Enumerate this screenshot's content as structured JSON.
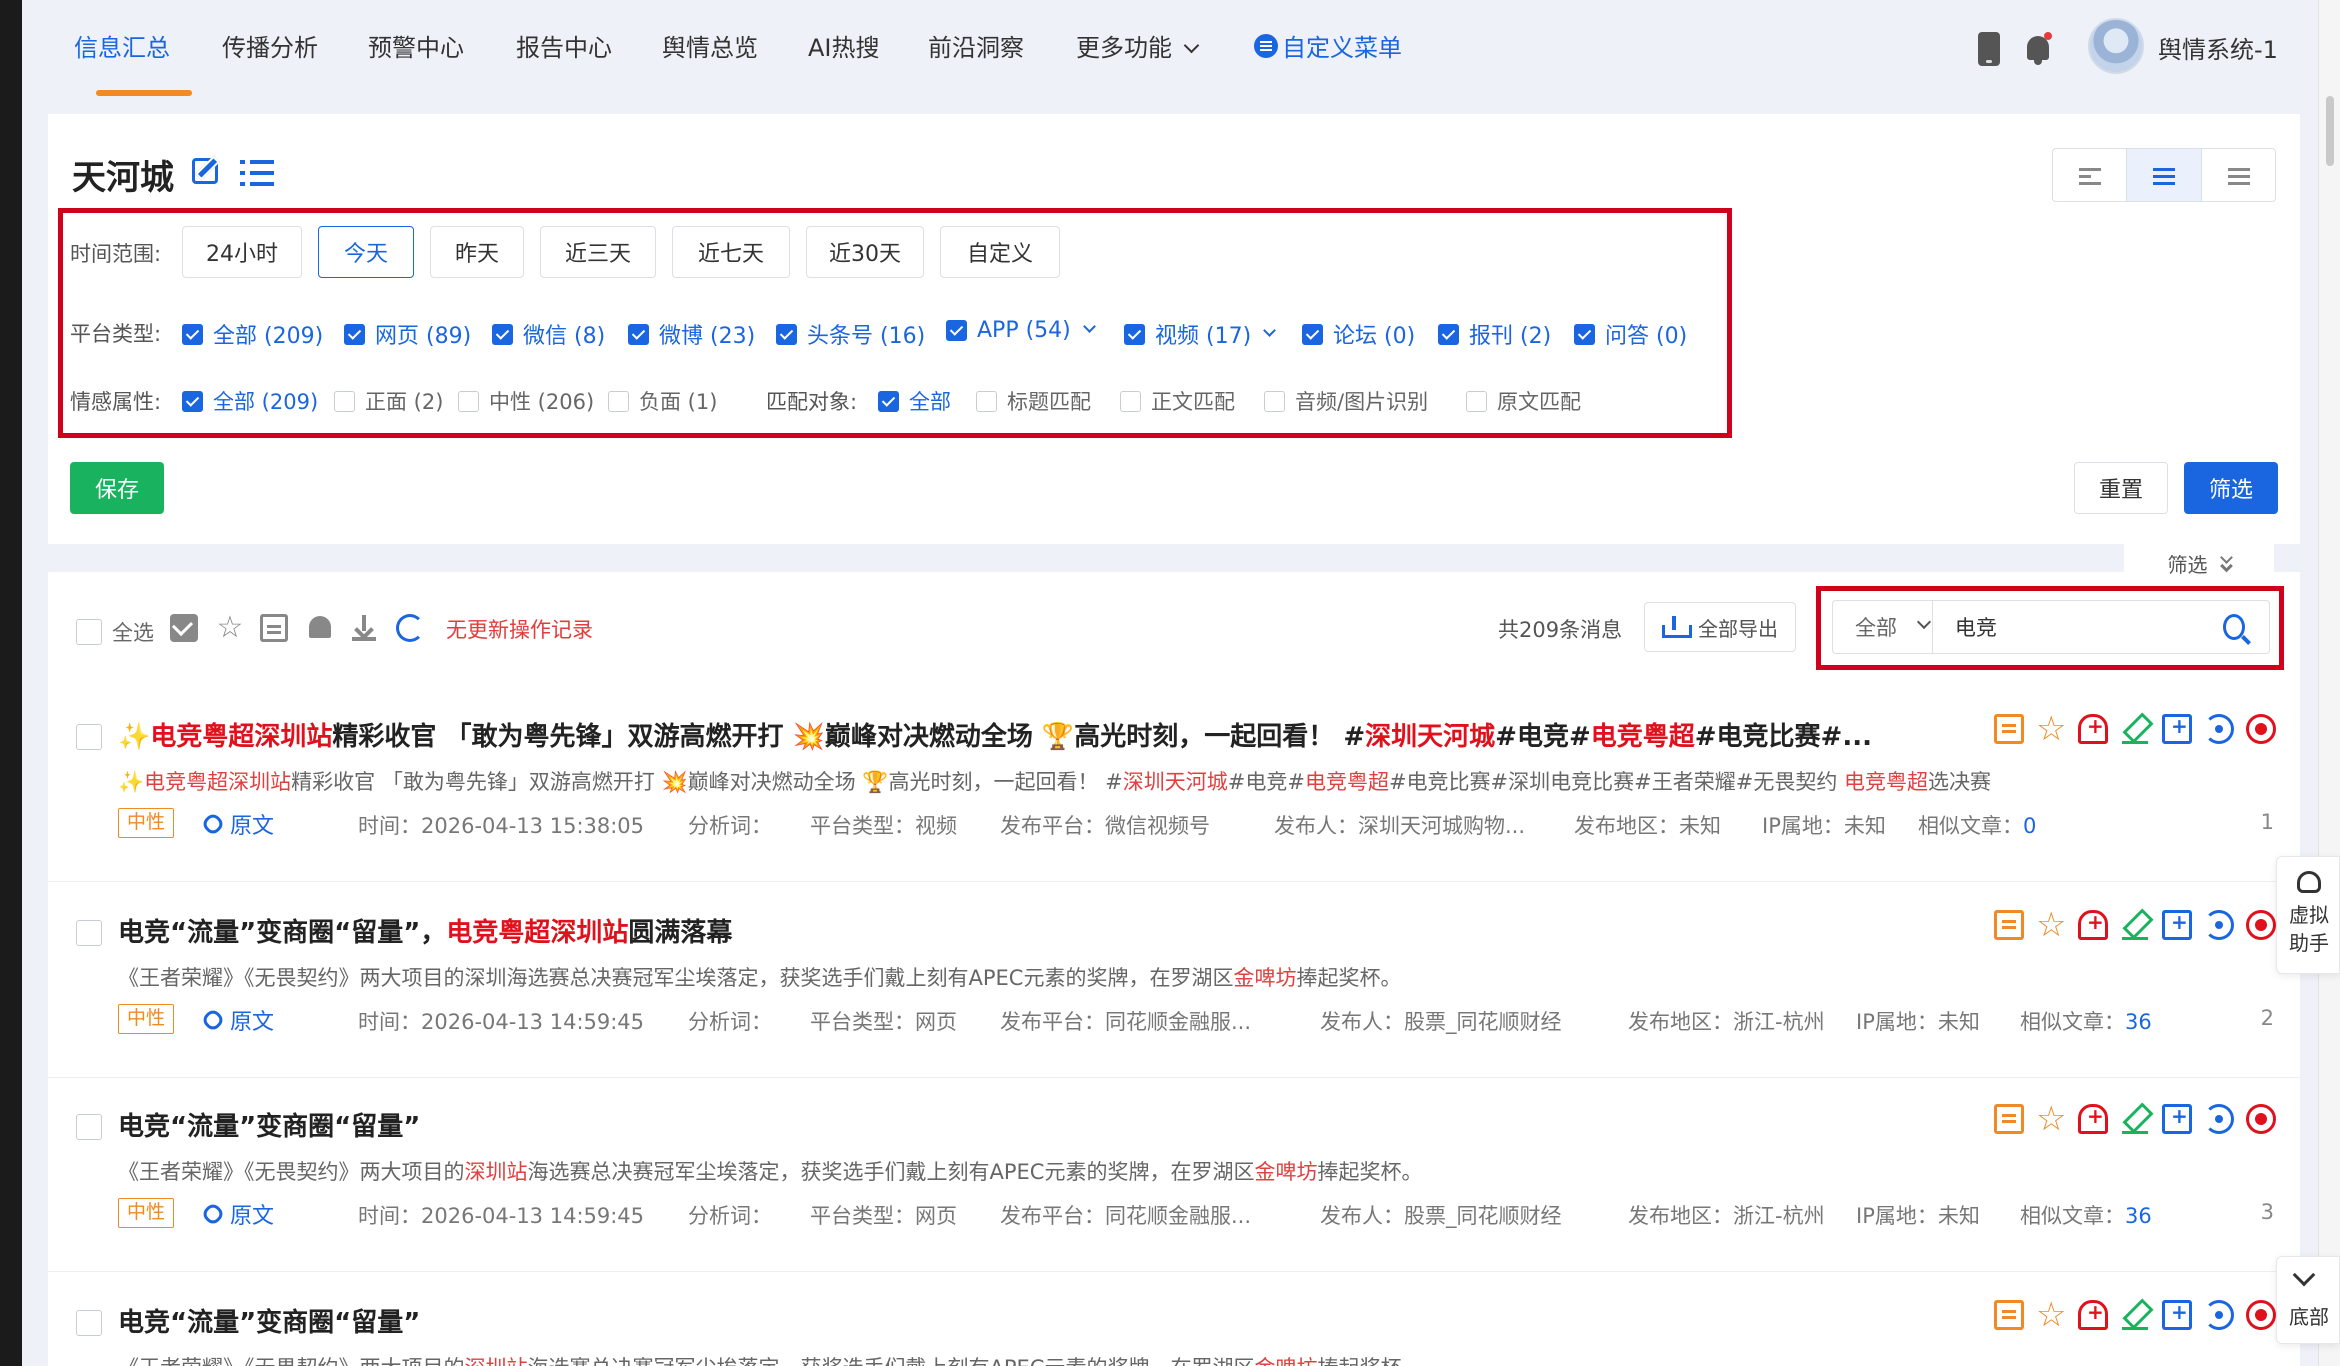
{
  "nav": {
    "tabs": [
      "信息汇总",
      "传播分析",
      "预警中心",
      "报告中心",
      "舆情总览",
      "AI热搜",
      "前沿洞察"
    ],
    "more_label": "更多功能",
    "custom_menu_label": "自定义菜单",
    "username": "舆情系统-1"
  },
  "filter": {
    "page_title": "天河城",
    "time_label": "时间范围:",
    "time_options": [
      "24小时",
      "今天",
      "昨天",
      "近三天",
      "近七天",
      "近30天",
      "自定义"
    ],
    "time_selected": "今天",
    "platform_label": "平台类型:",
    "platforms": [
      "全部 (209)",
      "网页 (89)",
      "微信 (8)",
      "微博 (23)",
      "头条号 (16)",
      "APP (54)",
      "视频 (17)",
      "论坛 (0)",
      "报刊 (2)",
      "问答 (0)"
    ],
    "sentiment_label": "情感属性:",
    "sentiments": [
      "全部 (209)",
      "正面 (2)",
      "中性 (206)",
      "负面 (1)"
    ],
    "match_label": "匹配对象:",
    "match_options": [
      "全部",
      "标题匹配",
      "正文匹配",
      "音频/图片识别",
      "原文匹配"
    ],
    "save_label": "保存",
    "reset_label": "重置",
    "submit_label": "筛选",
    "collapse_label": "筛选"
  },
  "toolbar": {
    "select_all_label": "全选",
    "no_record_label": "无更新操作记录",
    "total_label": "共209条消息",
    "export_label": "全部导出",
    "search_scope": "全部",
    "search_value": "电竞"
  },
  "items": [
    {
      "title_parts": [
        "✨",
        "电竞粤超深圳站",
        "精彩收官 「敢为粤先锋」双游高燃开打 💥巅峰对决燃动全场 🏆高光时刻，一起回看！ #",
        "深圳天河城",
        "#电竞#",
        "电竞粤超",
        "#电竞比赛#..."
      ],
      "summary_parts": [
        "✨",
        "电竞粤超深圳站",
        "精彩收官 「敢为粤先锋」双游高燃开打 💥巅峰对决燃动全场 🏆高光时刻，一起回看！ #",
        "深圳天河城",
        "#电竞#",
        "电竞粤超",
        "#电竞比赛#深圳电竞比赛#王者荣耀#无畏契约 ",
        "电竞粤超",
        "选决赛"
      ],
      "sentiment": "中性",
      "orig_label": "原文",
      "time": "时间：2026-04-13 15:38:05",
      "keywords": "分析词：",
      "platform_type": "平台类型：视频",
      "platform": "发布平台：微信视频号",
      "author": "发布人：深圳天河城购物...",
      "region": "发布地区：未知",
      "ip": "IP属地：未知",
      "similar_label": "相似文章：",
      "similar_count": "0",
      "index": "1"
    },
    {
      "title_parts": [
        "电竞“流量”变商圈“留量”，",
        "电竞粤超深圳站",
        "圆满落幕"
      ],
      "summary_parts": [
        "《王者荣耀》《无畏契约》两大项目的深圳海选赛总决赛冠军尘埃落定，获奖选手们戴上刻有APEC元素的奖牌，在罗湖区",
        "金啤坊",
        "捧起奖杯。"
      ],
      "sentiment": "中性",
      "orig_label": "原文",
      "time": "时间：2026-04-13 14:59:45",
      "keywords": "分析词：",
      "platform_type": "平台类型：网页",
      "platform": "发布平台：同花顺金融服...",
      "author": "发布人：股票_同花顺财经",
      "region": "发布地区：浙江-杭州",
      "ip": "IP属地：未知",
      "similar_label": "相似文章：",
      "similar_count": "36",
      "index": "2"
    },
    {
      "title_parts": [
        "电竞“流量”变商圈“留量”"
      ],
      "summary_parts": [
        "《王者荣耀》《无畏契约》两大项目的",
        "深圳站",
        "海选赛总决赛冠军尘埃落定，获奖选手们戴上刻有APEC元素的奖牌，在罗湖区",
        "金啤坊",
        "捧起奖杯。"
      ],
      "sentiment": "中性",
      "orig_label": "原文",
      "time": "时间：2026-04-13 14:59:45",
      "keywords": "分析词：",
      "platform_type": "平台类型：网页",
      "platform": "发布平台：同花顺金融服...",
      "author": "发布人：股票_同花顺财经",
      "region": "发布地区：浙江-杭州",
      "ip": "IP属地：未知",
      "similar_label": "相似文章：",
      "similar_count": "36",
      "index": "3"
    },
    {
      "title_parts": [
        "电竞“流量”变商圈“留量”"
      ],
      "summary_parts": [
        "《王者荣耀》《无畏契约》两大项目的",
        "深圳站",
        "海选赛总决赛冠军尘埃落定，获奖选手们戴上刻有APEC元素的奖牌，在罗湖区",
        "金啤坊",
        "捧起奖杯。"
      ]
    }
  ],
  "widgets": {
    "assistant_label": "虚拟助手",
    "bottom_label": "底部"
  },
  "colors": {
    "accent": "#1a66e0",
    "highlight": "#e0101c",
    "save": "#19b35f",
    "annotation_box": "#d0021b",
    "tab_underline": "#f08a24"
  }
}
